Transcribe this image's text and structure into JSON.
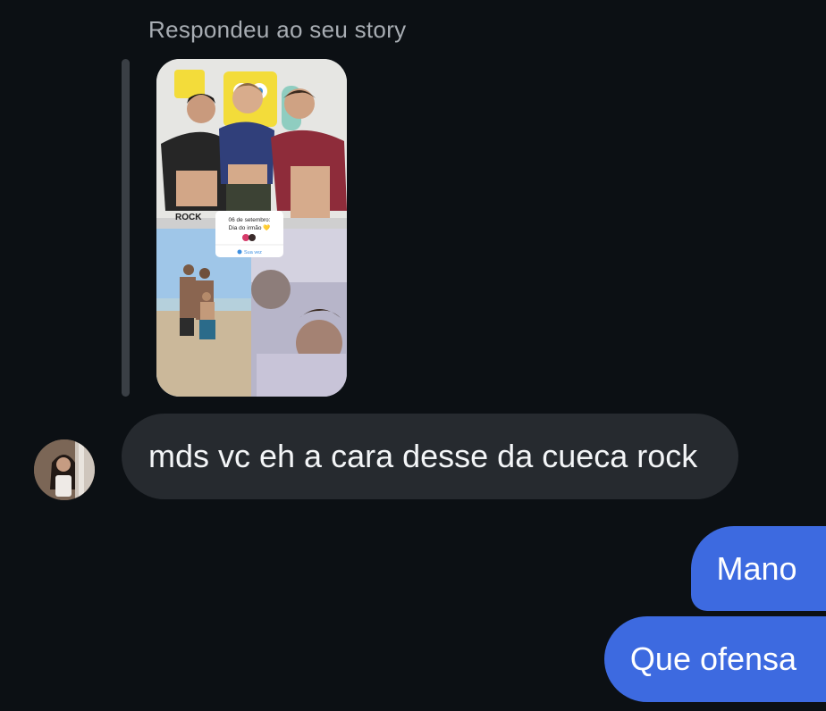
{
  "thread": {
    "reply_label": "Respondeu ao seu story",
    "story": {
      "sticker_line1": "06 de setembro:",
      "sticker_line2": "Dia do irmão 💛",
      "sticker_footer": "Sua vez",
      "shorts_text": "ROCK"
    }
  },
  "messages": {
    "incoming": {
      "text": "mds vc eh a cara desse da cueca rock"
    },
    "outgoing": [
      {
        "text": "Mano"
      },
      {
        "text": "Que ofensa"
      }
    ]
  },
  "colors": {
    "background": "#0c1014",
    "incoming_bubble": "#262a2f",
    "outgoing_bubble": "#3d6ae0",
    "label_text": "#a8adb3"
  }
}
